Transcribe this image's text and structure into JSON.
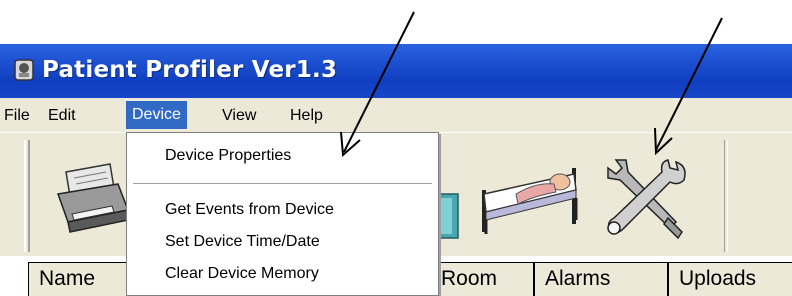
{
  "window": {
    "title": "Patient Profiler Ver1.3",
    "title_bar_color": "#1c4fd0"
  },
  "menubar": {
    "items": [
      {
        "label": "File"
      },
      {
        "label": "Edit"
      },
      {
        "label": "Device",
        "active": true
      },
      {
        "label": "View"
      },
      {
        "label": "Help"
      }
    ],
    "active_color": "#316ac5"
  },
  "device_menu": {
    "items": [
      {
        "label": "Device Properties"
      },
      {
        "label": "Get Events from Device"
      },
      {
        "label": "Set Device Time/Date"
      },
      {
        "label": "Clear Device Memory"
      }
    ]
  },
  "toolbar": {
    "icons": [
      "printer-icon",
      "device-icon",
      "bed-icon",
      "tools-icon"
    ]
  },
  "table": {
    "columns": [
      "Name",
      "Room",
      "Alarms",
      "Uploads"
    ]
  }
}
